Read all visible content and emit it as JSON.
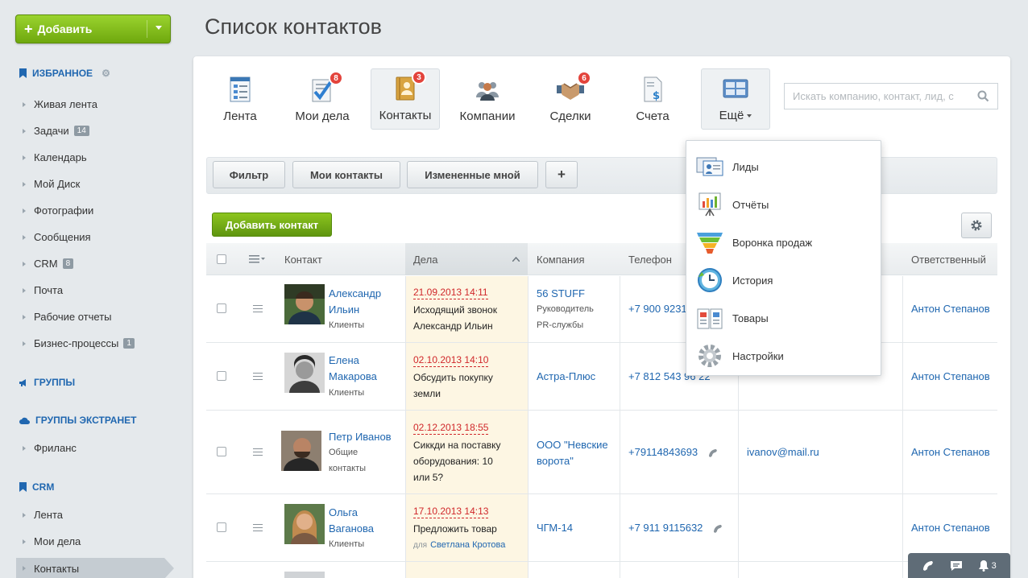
{
  "sidebar": {
    "add_button": "Добавить",
    "favorites_title": "ИЗБРАННОЕ",
    "favorites": [
      {
        "label": "Живая лента",
        "count": ""
      },
      {
        "label": "Задачи",
        "count": "14"
      },
      {
        "label": "Календарь",
        "count": ""
      },
      {
        "label": "Мой Диск",
        "count": ""
      },
      {
        "label": "Фотографии",
        "count": ""
      },
      {
        "label": "Сообщения",
        "count": ""
      },
      {
        "label": "CRM",
        "count": "8"
      },
      {
        "label": "Почта",
        "count": ""
      },
      {
        "label": "Рабочие отчеты",
        "count": ""
      },
      {
        "label": "Бизнес-процессы",
        "count": "1"
      }
    ],
    "groups_title": "ГРУППЫ",
    "extranet_title": "ГРУППЫ ЭКСТРАНЕТ",
    "extranet_items": [
      "Фриланс"
    ],
    "crm_title": "CRM",
    "crm_items": [
      "Лента",
      "Мои дела",
      "Контакты"
    ]
  },
  "main": {
    "title": "Список контактов",
    "toolbar": [
      {
        "label": "Лента",
        "badge": ""
      },
      {
        "label": "Мои дела",
        "badge": "8"
      },
      {
        "label": "Контакты",
        "badge": "3"
      },
      {
        "label": "Компании",
        "badge": ""
      },
      {
        "label": "Сделки",
        "badge": "6"
      },
      {
        "label": "Счета",
        "badge": ""
      },
      {
        "label": "Ещё",
        "badge": ""
      }
    ],
    "search_placeholder": "Искать компанию, контакт, лид, с",
    "filters": [
      "Фильтр",
      "Мои контакты",
      "Измененные мной",
      "+"
    ],
    "add_contact": "Добавить контакт",
    "columns": [
      "Контакт",
      "Дела",
      "Компания",
      "Телефон",
      "Ответственный"
    ],
    "rows": [
      {
        "name1": "Александр",
        "name2": "Ильин",
        "type1": "Клиенты",
        "type2": "",
        "date": "21.09.2013 14:11",
        "deal": [
          "Исходящий звонок",
          "Александр Ильин"
        ],
        "deal_for": "",
        "deal_person": "",
        "company": "56 STUFF",
        "company_sub": [
          "Руководитель",
          "PR-службы"
        ],
        "phone": "+7 900 9231",
        "email": "",
        "owner": "Антон Степанов"
      },
      {
        "name1": "Елена",
        "name2": "Макарова",
        "type1": "Клиенты",
        "type2": "",
        "date": "02.10.2013 14:10",
        "deal": [
          "Обсудить покупку",
          "земли"
        ],
        "deal_for": "",
        "deal_person": "",
        "company": "Астра-Плюс",
        "company_sub": [],
        "phone": "+7 812 543 96 22",
        "email": "",
        "owner": "Антон Степанов"
      },
      {
        "name1": "Петр Иванов",
        "name2": "",
        "type1": "Общие",
        "type2": "контакты",
        "date": "02.12.2013 18:55",
        "deal": [
          "Сиккди на поставку",
          "оборудования: 10",
          "или 5?"
        ],
        "deal_for": "",
        "deal_person": "",
        "company": "ООО \"Невские",
        "company2": "ворота\"",
        "company_sub": [],
        "phone": "+79114843693",
        "email": "ivanov@mail.ru",
        "owner": "Антон Степанов"
      },
      {
        "name1": "Ольга",
        "name2": "Ваганова",
        "type1": "Клиенты",
        "type2": "",
        "date": "17.10.2013 14:13",
        "deal": [
          "Предложить товар"
        ],
        "deal_for": "для",
        "deal_person": "Светлана Кротова",
        "company": "ЧГМ-14",
        "company_sub": [],
        "phone": "+7 911 9115632",
        "email": "",
        "owner": "Антон Степанов"
      }
    ]
  },
  "more_menu": [
    "Лиды",
    "Отчёты",
    "Воронка продаж",
    "История",
    "Товары",
    "Настройки"
  ],
  "bottombar": {
    "notifications": "3"
  },
  "colors": {
    "accent": "#2067b0",
    "green": "#6fa80e",
    "badge": "#e3443c",
    "date": "#d0272a"
  }
}
